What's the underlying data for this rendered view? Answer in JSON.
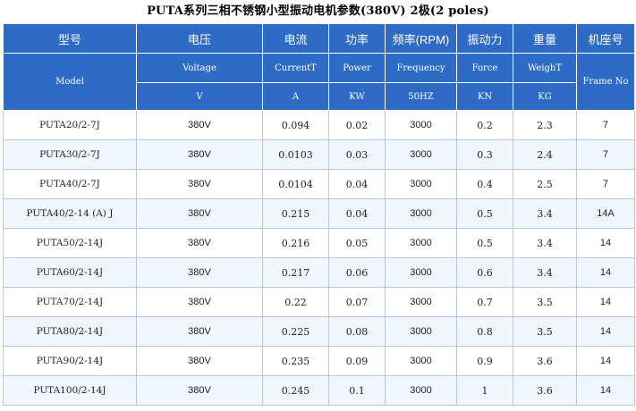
{
  "title": "PUTA系列三相不锈钢小型振动电机参数(380V) 2极(2 poles)",
  "header": {
    "cn": [
      "型号",
      "电压",
      "电流",
      "功率",
      "频率(RPM)",
      "振动力",
      "重量",
      "机座号"
    ],
    "en": [
      "Model",
      "Voltage",
      "CurrentT",
      "Power",
      "Frequency",
      "Force",
      "WeighT",
      "Frame No"
    ],
    "units": [
      "V",
      "A",
      "KW",
      "50HZ",
      "KN",
      "KG"
    ]
  },
  "rows": [
    {
      "model": "PUTA20/2-7J",
      "voltage": "380V",
      "current": "0.094",
      "power": "0.02",
      "freq": "3000",
      "force": "0.2",
      "weight": "2.3",
      "frame": "7"
    },
    {
      "model": "PUTA30/2-7J",
      "voltage": "380V",
      "current": "0.0103",
      "power": "0.03",
      "freq": "3000",
      "force": "0.3",
      "weight": "2.4",
      "frame": "7"
    },
    {
      "model": "PUTA40/2-7J",
      "voltage": "380V",
      "current": "0.0104",
      "power": "0.04",
      "freq": "3000",
      "force": "0.4",
      "weight": "2.5",
      "frame": "7"
    },
    {
      "model": "PUTA40/2-14 (A) J",
      "voltage": "380V",
      "current": "0.215",
      "power": "0.04",
      "freq": "3000",
      "force": "0.5",
      "weight": "3.4",
      "frame": "14A"
    },
    {
      "model": "PUTA50/2-14J",
      "voltage": "380V",
      "current": "0.216",
      "power": "0.05",
      "freq": "3000",
      "force": "0.5",
      "weight": "3.4",
      "frame": "14"
    },
    {
      "model": "PUTA60/2-14J",
      "voltage": "380V",
      "current": "0.217",
      "power": "0.06",
      "freq": "3000",
      "force": "0.6",
      "weight": "3.4",
      "frame": "14"
    },
    {
      "model": "PUTA70/2-14J",
      "voltage": "380V",
      "current": "0.22",
      "power": "0.07",
      "freq": "3000",
      "force": "0.7",
      "weight": "3.5",
      "frame": "14"
    },
    {
      "model": "PUTA80/2-14J",
      "voltage": "380V",
      "current": "0.225",
      "power": "0.08",
      "freq": "3000",
      "force": "0.8",
      "weight": "3.5",
      "frame": "14"
    },
    {
      "model": "PUTA90/2-14J",
      "voltage": "380V",
      "current": "0.235",
      "power": "0.09",
      "freq": "3000",
      "force": "0.9",
      "weight": "3.6",
      "frame": "14"
    },
    {
      "model": "PUTA100/2-14J",
      "voltage": "380V",
      "current": "0.245",
      "power": "0.1",
      "freq": "3000",
      "force": "1",
      "weight": "3.6",
      "frame": "14"
    }
  ],
  "colors": {
    "header_bg": "#2e6bc6",
    "header_text": "#ffffff",
    "row_alt": "#f1f6fd",
    "grid": "#b9c7dc"
  }
}
